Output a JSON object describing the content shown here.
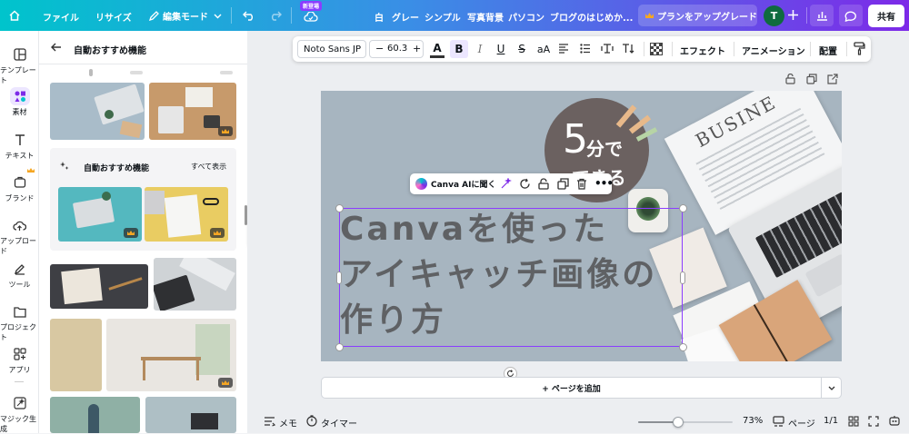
{
  "topbar": {
    "file_label": "ファイル",
    "resize_label": "リサイズ",
    "edit_mode_label": "編集モード",
    "new_badge": "新登場",
    "tags": [
      "白",
      "グレー",
      "シンプル",
      "写真背景",
      "パソコン",
      "ブログのはじめか..."
    ],
    "upgrade_label": "プランをアップグレード",
    "avatar_initial": "T",
    "share_label": "共有"
  },
  "rail": {
    "items": [
      {
        "label": "テンプレート",
        "icon": "template-icon"
      },
      {
        "label": "素材",
        "icon": "elements-icon"
      },
      {
        "label": "テキスト",
        "icon": "text-icon"
      },
      {
        "label": "ブランド",
        "icon": "brand-icon"
      },
      {
        "label": "アップロード",
        "icon": "upload-icon"
      },
      {
        "label": "ツール",
        "icon": "tools-icon"
      },
      {
        "label": "プロジェクト",
        "icon": "folder-icon"
      },
      {
        "label": "アプリ",
        "icon": "apps-icon"
      },
      {
        "label": "マジック生成",
        "icon": "magic-icon"
      }
    ]
  },
  "panel": {
    "header_title": "自動おすすめ機能",
    "section_title": "自動おすすめ機能",
    "see_all": "すべて表示"
  },
  "format_bar": {
    "font_family": "Noto Sans JP",
    "font_size": "60.3",
    "effects_label": "エフェクト",
    "animation_label": "アニメーション",
    "position_label": "配置"
  },
  "context_bar": {
    "ask_ai_label": "Canva AIに聞く"
  },
  "canvas": {
    "headline_lines": [
      "Canvaを使った",
      "アイキャッチ画像の",
      "作り方"
    ],
    "badge_number": "5",
    "badge_line1": "分で",
    "badge_line2": "できる",
    "newspaper_text": "BUSINE"
  },
  "add_page_label": "+ ページを追加",
  "bottom": {
    "memo_label": "メモ",
    "timer_label": "タイマー",
    "zoom": "73%",
    "zoom_fraction": 0.42,
    "pages_label": "ページ",
    "page_count": "1/1"
  },
  "colors": {
    "topbar_start": "#00c4cc",
    "topbar_end": "#7d2ae8",
    "accent": "#8b3dff",
    "avatar_bg": "#0f6b3f",
    "canvas_bg": "#a7b5c0",
    "headline": "#5f6164",
    "badge_bg": "#6b6160",
    "premium": "#f5a623"
  }
}
